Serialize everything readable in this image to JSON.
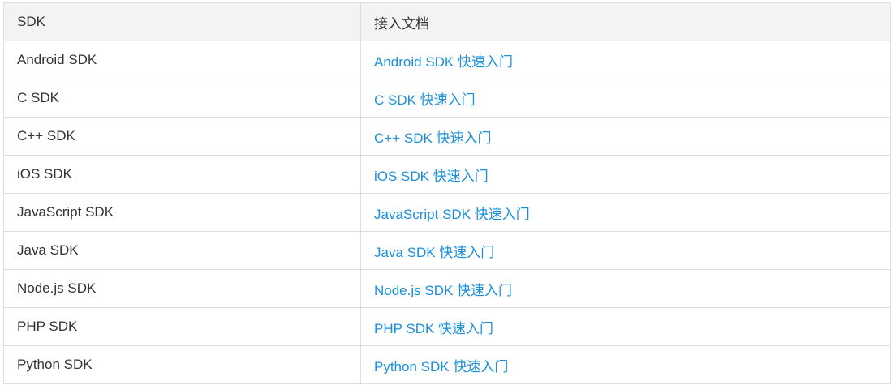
{
  "table": {
    "headers": {
      "sdk": "SDK",
      "docs": "接入文档"
    },
    "rows": [
      {
        "sdk": "Android SDK",
        "doc_link": "Android SDK 快速入门"
      },
      {
        "sdk": "C SDK",
        "doc_link": "C SDK 快速入门"
      },
      {
        "sdk": "C++ SDK",
        "doc_link": "C++ SDK 快速入门"
      },
      {
        "sdk": "iOS SDK",
        "doc_link": "iOS SDK 快速入门"
      },
      {
        "sdk": "JavaScript SDK",
        "doc_link": "JavaScript SDK 快速入门"
      },
      {
        "sdk": "Java SDK",
        "doc_link": "Java SDK 快速入门"
      },
      {
        "sdk": "Node.js SDK",
        "doc_link": "Node.js SDK 快速入门"
      },
      {
        "sdk": "PHP SDK",
        "doc_link": "PHP SDK 快速入门"
      },
      {
        "sdk": "Python SDK",
        "doc_link": "Python SDK 快速入门"
      }
    ]
  },
  "colors": {
    "link": "#1a8fdb",
    "header_bg": "#f3f3f3",
    "border": "#dddddd",
    "text": "#333333"
  }
}
